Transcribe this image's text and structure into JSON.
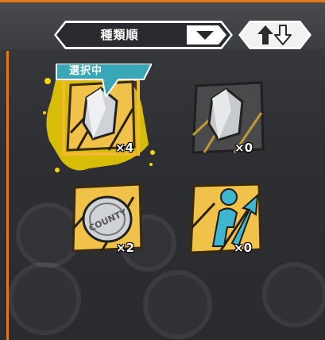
{
  "sort": {
    "label": "種類順",
    "dropdown_icon": "chevron-down-icon"
  },
  "order_button": {
    "icons": [
      "arrow-up-icon",
      "arrow-down-icon"
    ]
  },
  "selected_banner": {
    "label": "選択中"
  },
  "items": [
    {
      "name": "silver-crystal",
      "icon": "crystal-icon",
      "count": "×4",
      "selected": true,
      "frame_color": "#f0b930"
    },
    {
      "name": "dark-crystal",
      "icon": "crystal-icon",
      "count": "×0",
      "selected": false,
      "frame_color": "#4a4a4a"
    },
    {
      "name": "county-coin",
      "icon": "coin-icon",
      "count": "×2",
      "selected": false,
      "frame_color": "#f0b930"
    },
    {
      "name": "level-up-figure",
      "icon": "person-arrow-icon",
      "count": "×0",
      "selected": false,
      "frame_color": "#f0b930"
    }
  ],
  "coin_text": "COUNTY",
  "colors": {
    "accent_orange": "#e07a1a",
    "gold": "#f0b930",
    "selected_teal": "#3aa7b8",
    "highlight_yellow": "#f5d600"
  }
}
